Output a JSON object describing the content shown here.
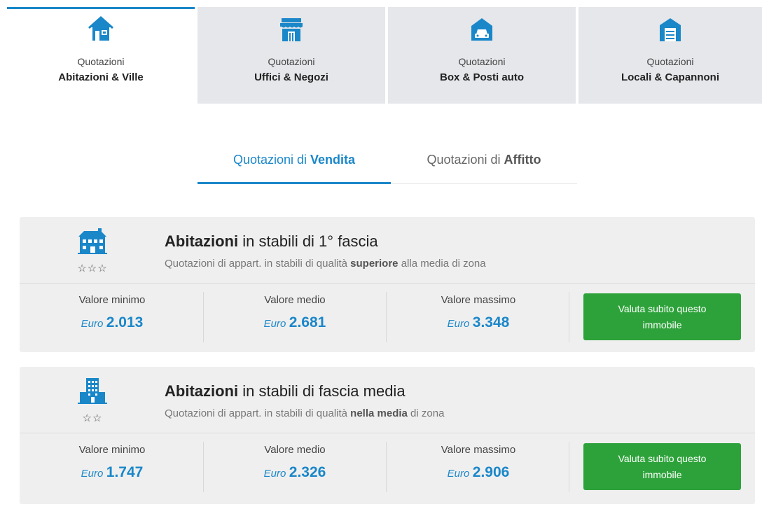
{
  "colors": {
    "accent": "#1a87c9",
    "tab_inactive_bg": "#e5e7ea",
    "card_bg": "#efefef",
    "cta_bg": "#2da23a"
  },
  "category_tabs": [
    {
      "line1": "Quotazioni",
      "line2": "Abitazioni & Ville",
      "icon": "house-icon",
      "active": true
    },
    {
      "line1": "Quotazioni",
      "line2": "Uffici & Negozi",
      "icon": "shop-icon",
      "active": false
    },
    {
      "line1": "Quotazioni",
      "line2": "Box & Posti auto",
      "icon": "car-icon",
      "active": false
    },
    {
      "line1": "Quotazioni",
      "line2": "Locali & Capannoni",
      "icon": "warehouse-icon",
      "active": false
    }
  ],
  "sub_tabs": {
    "sale": {
      "prefix": "Quotazioni di ",
      "bold": "Vendita",
      "active": true
    },
    "rent": {
      "prefix": "Quotazioni di ",
      "bold": "Affitto",
      "active": false
    }
  },
  "cards": [
    {
      "title_bold": "Abitazioni",
      "title_rest": " in stabili di 1° fascia",
      "desc_pre": "Quotazioni di appart. in stabili di qualità ",
      "desc_bold": "superiore",
      "desc_post": " alla media di zona",
      "stars": "☆☆☆",
      "icon": "villa-building-icon",
      "min": {
        "label": "Valore minimo",
        "currency": "Euro",
        "value": "2.013"
      },
      "mid": {
        "label": "Valore medio",
        "currency": "Euro",
        "value": "2.681"
      },
      "max": {
        "label": "Valore massimo",
        "currency": "Euro",
        "value": "3.348"
      },
      "cta_line1": "Valuta subito questo",
      "cta_line2": "immobile"
    },
    {
      "title_bold": "Abitazioni",
      "title_rest": " in stabili di fascia media",
      "desc_pre": "Quotazioni di appart. in stabili di qualità ",
      "desc_bold": "nella media",
      "desc_post": " di zona",
      "stars": "☆☆",
      "icon": "apartment-building-icon",
      "min": {
        "label": "Valore minimo",
        "currency": "Euro",
        "value": "1.747"
      },
      "mid": {
        "label": "Valore medio",
        "currency": "Euro",
        "value": "2.326"
      },
      "max": {
        "label": "Valore massimo",
        "currency": "Euro",
        "value": "2.906"
      },
      "cta_line1": "Valuta subito questo",
      "cta_line2": "immobile"
    }
  ]
}
